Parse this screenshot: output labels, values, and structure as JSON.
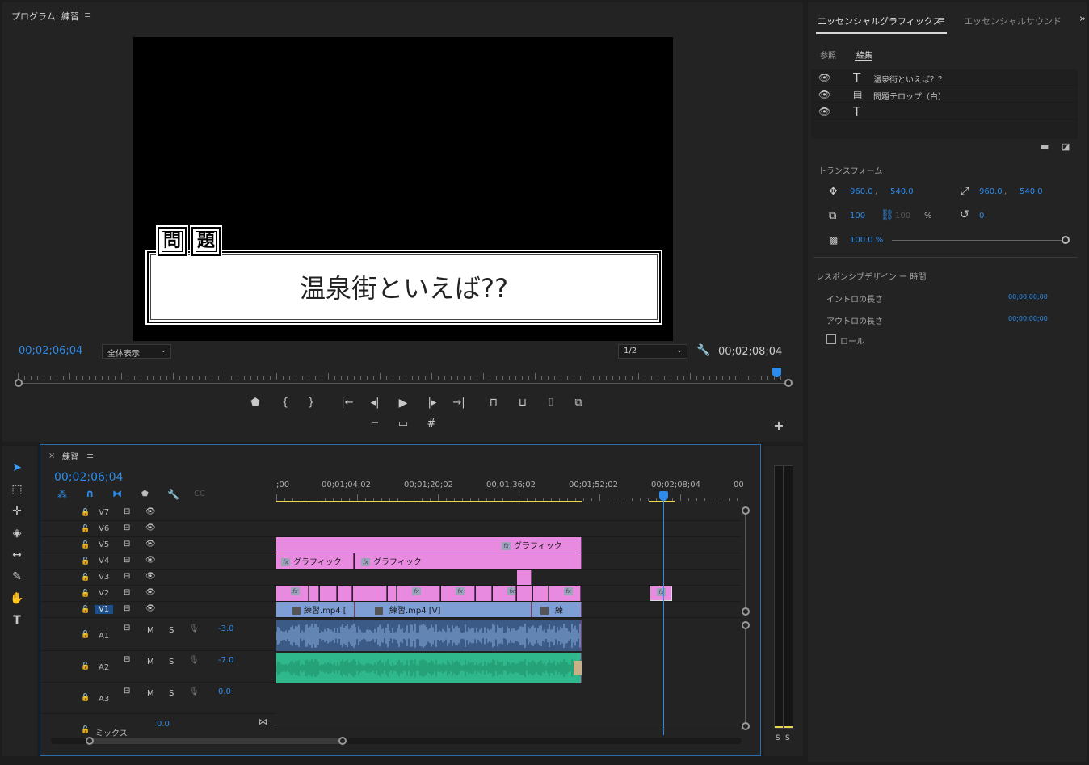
{
  "program": {
    "title": "プログラム: 練習",
    "timecode_current": "00;02;06;04",
    "timecode_duration": "00;02;08;04",
    "zoom_select": "全体表示",
    "resolution_select": "1/2",
    "telop_text": "温泉街といえば??",
    "badge_1": "問",
    "badge_2": "題"
  },
  "essential_graphics": {
    "tab_graphics": "エッセンシャルグラフィックス",
    "tab_sound": "エッセンシャルサウンド",
    "subtab_browse": "参照",
    "subtab_edit": "編集",
    "layers": [
      {
        "name": "温泉街といえば？？",
        "type": "text"
      },
      {
        "name": "問題テロップ（白）",
        "type": "shape"
      },
      {
        "name": "",
        "type": "text"
      }
    ],
    "transform_label": "トランスフォーム",
    "position_x": "960.0",
    "position_y": "540.0",
    "anchor_x": "960.0",
    "anchor_y": "540.0",
    "scale": "100",
    "scale_linked": "100",
    "scale_unit": "%",
    "rotation": "0",
    "opacity": "100.0 %",
    "opacity_level": 1.0,
    "responsive_label": "レスポンシブデザイン ー 時間",
    "intro_label": "イントロの長さ",
    "intro_value": "00;00;00;00",
    "outro_label": "アウトロの長さ",
    "outro_value": "00;00;00;00",
    "roll_label": "ロール",
    "roll_checked": false
  },
  "timeline": {
    "sequence_name": "練習",
    "timecode": "00;02;06;04",
    "ruler_labels": [
      ";00",
      "00;01;04;02",
      "00;01;20;02",
      "00;01;36;02",
      "00;01;52;02",
      "00;02;08;04",
      "00"
    ],
    "video_tracks": [
      "V7",
      "V6",
      "V5",
      "V4",
      "V3",
      "V2",
      "V1"
    ],
    "audio_tracks": [
      {
        "name": "A1",
        "volume": "-3.0"
      },
      {
        "name": "A2",
        "volume": "-7.0"
      },
      {
        "name": "A3",
        "volume": "0.0"
      }
    ],
    "mix_label": "ミックス",
    "mix_value": "0.0",
    "clip_graphic": "グラフィック",
    "clip_v1_a": "練習.mp4 [",
    "clip_v1_b": "練習.mp4 [V]",
    "clip_v1_c": "練",
    "mute_label": "M",
    "solo_label": "S"
  },
  "meter": {
    "s_left": "S",
    "s_right": "S"
  },
  "colors": {
    "accent": "#2d8ceb",
    "clip_pink": "#e88ae0",
    "clip_blue": "#7e9fd6",
    "audio_green": "#2fb88c"
  }
}
